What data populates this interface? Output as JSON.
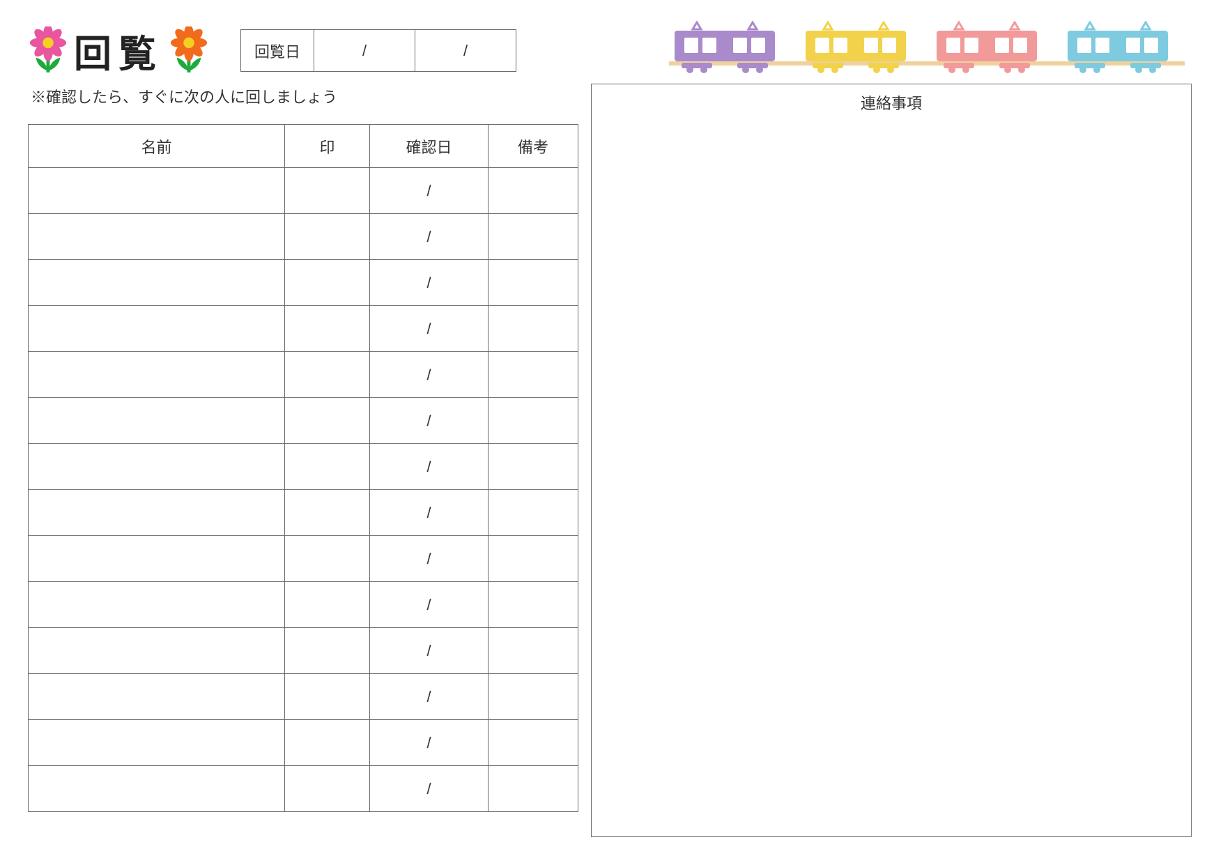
{
  "title": "回覧",
  "date_label": "回覧日",
  "date_cells": [
    "/",
    "/"
  ],
  "note": "※確認したら、すぐに次の人に回しましょう",
  "columns": {
    "name": "名前",
    "stamp": "印",
    "date": "確認日",
    "remark": "備考"
  },
  "rows": [
    {
      "name": "",
      "stamp": "",
      "date": "/",
      "remark": ""
    },
    {
      "name": "",
      "stamp": "",
      "date": "/",
      "remark": ""
    },
    {
      "name": "",
      "stamp": "",
      "date": "/",
      "remark": ""
    },
    {
      "name": "",
      "stamp": "",
      "date": "/",
      "remark": ""
    },
    {
      "name": "",
      "stamp": "",
      "date": "/",
      "remark": ""
    },
    {
      "name": "",
      "stamp": "",
      "date": "/",
      "remark": ""
    },
    {
      "name": "",
      "stamp": "",
      "date": "/",
      "remark": ""
    },
    {
      "name": "",
      "stamp": "",
      "date": "/",
      "remark": ""
    },
    {
      "name": "",
      "stamp": "",
      "date": "/",
      "remark": ""
    },
    {
      "name": "",
      "stamp": "",
      "date": "/",
      "remark": ""
    },
    {
      "name": "",
      "stamp": "",
      "date": "/",
      "remark": ""
    },
    {
      "name": "",
      "stamp": "",
      "date": "/",
      "remark": ""
    },
    {
      "name": "",
      "stamp": "",
      "date": "/",
      "remark": ""
    },
    {
      "name": "",
      "stamp": "",
      "date": "/",
      "remark": ""
    }
  ],
  "memo_title": "連絡事項",
  "decor": {
    "flower_left": {
      "petals": "#e9559f",
      "center": "#f6cf24",
      "stem": "#1eaa3c"
    },
    "flower_right": {
      "petals": "#f26a1b",
      "center": "#f6cf24",
      "stem": "#1eaa3c"
    },
    "train_colors": [
      "#a98acb",
      "#f2d24a",
      "#f29a9a",
      "#7ecbe0"
    ]
  }
}
